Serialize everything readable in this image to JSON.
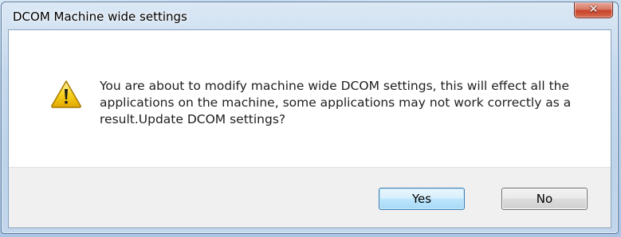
{
  "window": {
    "title": "DCOM Machine wide settings",
    "close_glyph": "✕"
  },
  "dialog": {
    "icon": "warning-icon",
    "message": "You are about to modify machine wide DCOM settings, this will effect all the applications on the machine, some applications may not work correctly as a result.Update DCOM settings?"
  },
  "buttons": {
    "yes_label": "Yes",
    "no_label": "No"
  },
  "colors": {
    "warning_fill": "#f7c600",
    "warning_border": "#a67a00",
    "default_button_border": "#3c7fb1",
    "close_button": "#c7432a"
  }
}
